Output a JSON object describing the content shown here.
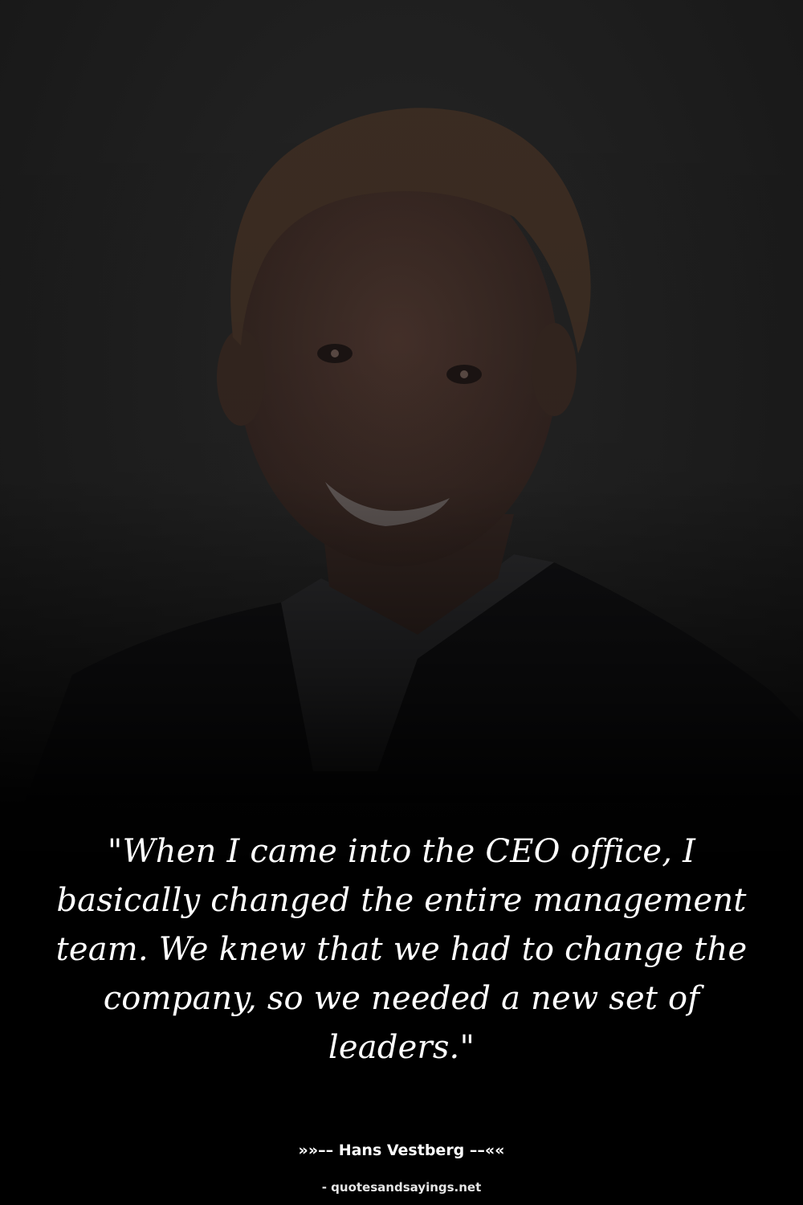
{
  "photo": {
    "description_icon": "portrait-photo",
    "background_color": "#1e1e1e",
    "skin_color": "#3a2a24",
    "hair_color": "#3d2f24",
    "suit_color": "#121214"
  },
  "quote": {
    "text": "\"When I came into the CEO office, I basically changed the entire management team. We knew that we had to change the company, so we needed a new set of leaders.\""
  },
  "attribution": {
    "text": "»»–– Hans Vestberg ––««"
  },
  "site_credit": {
    "text": "- quotesandsayings.net"
  }
}
